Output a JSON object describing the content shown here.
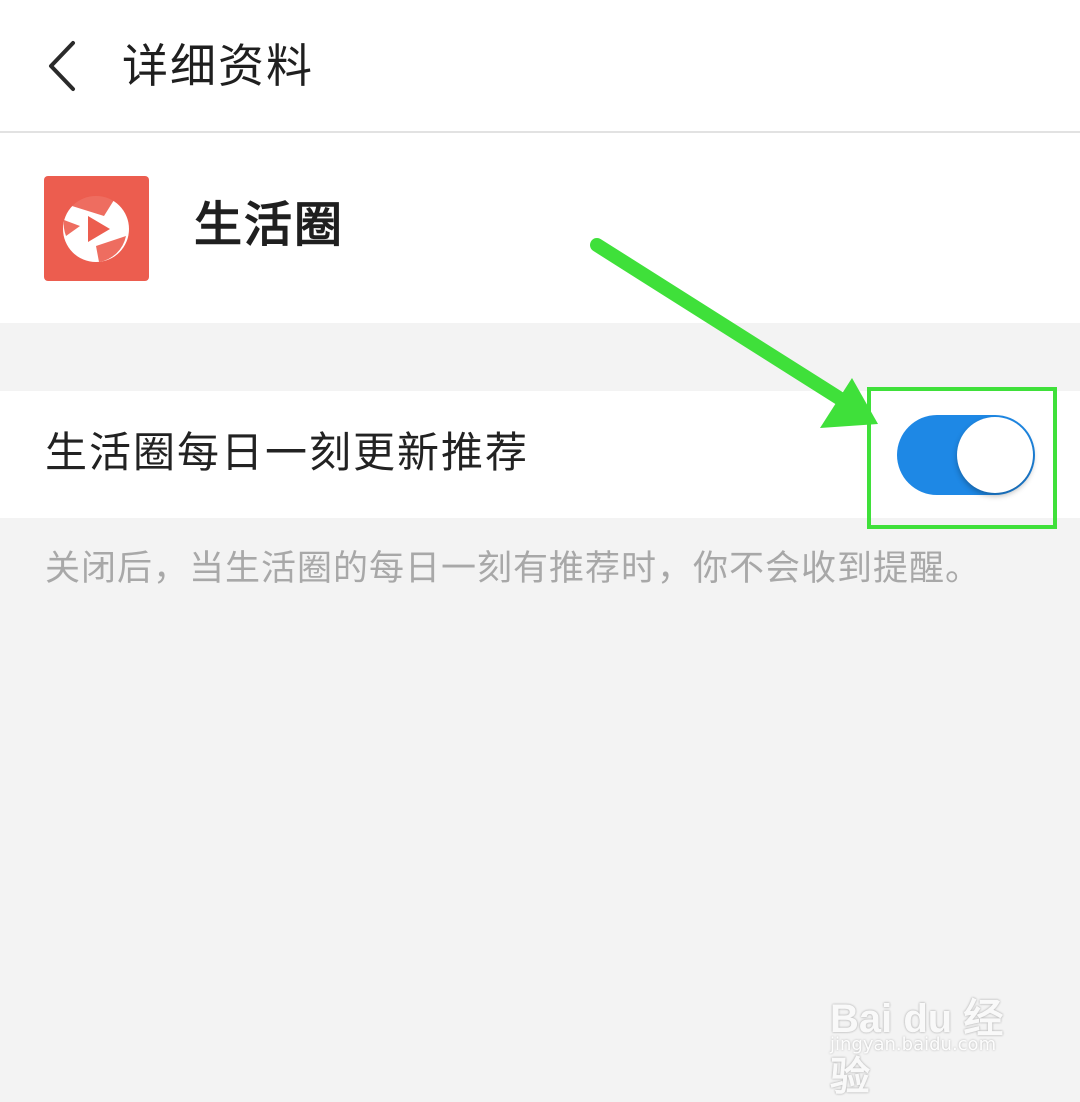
{
  "header": {
    "title": "详细资料",
    "back_icon": "chevron-left-icon"
  },
  "profile": {
    "name": "生活圈",
    "icon": "play-circle-icon",
    "icon_color": "#ec5d4f"
  },
  "setting": {
    "label": "生活圈每日一刻更新推荐",
    "toggle_on": true,
    "toggle_color": "#1e88e5"
  },
  "description": "关闭后，当生活圈的每日一刻有推荐时，你不会收到提醒。",
  "annotation": {
    "color": "#3fe03a"
  },
  "watermark": {
    "logo": "Bai du 经验",
    "url": "jingyan.baidu.com"
  }
}
